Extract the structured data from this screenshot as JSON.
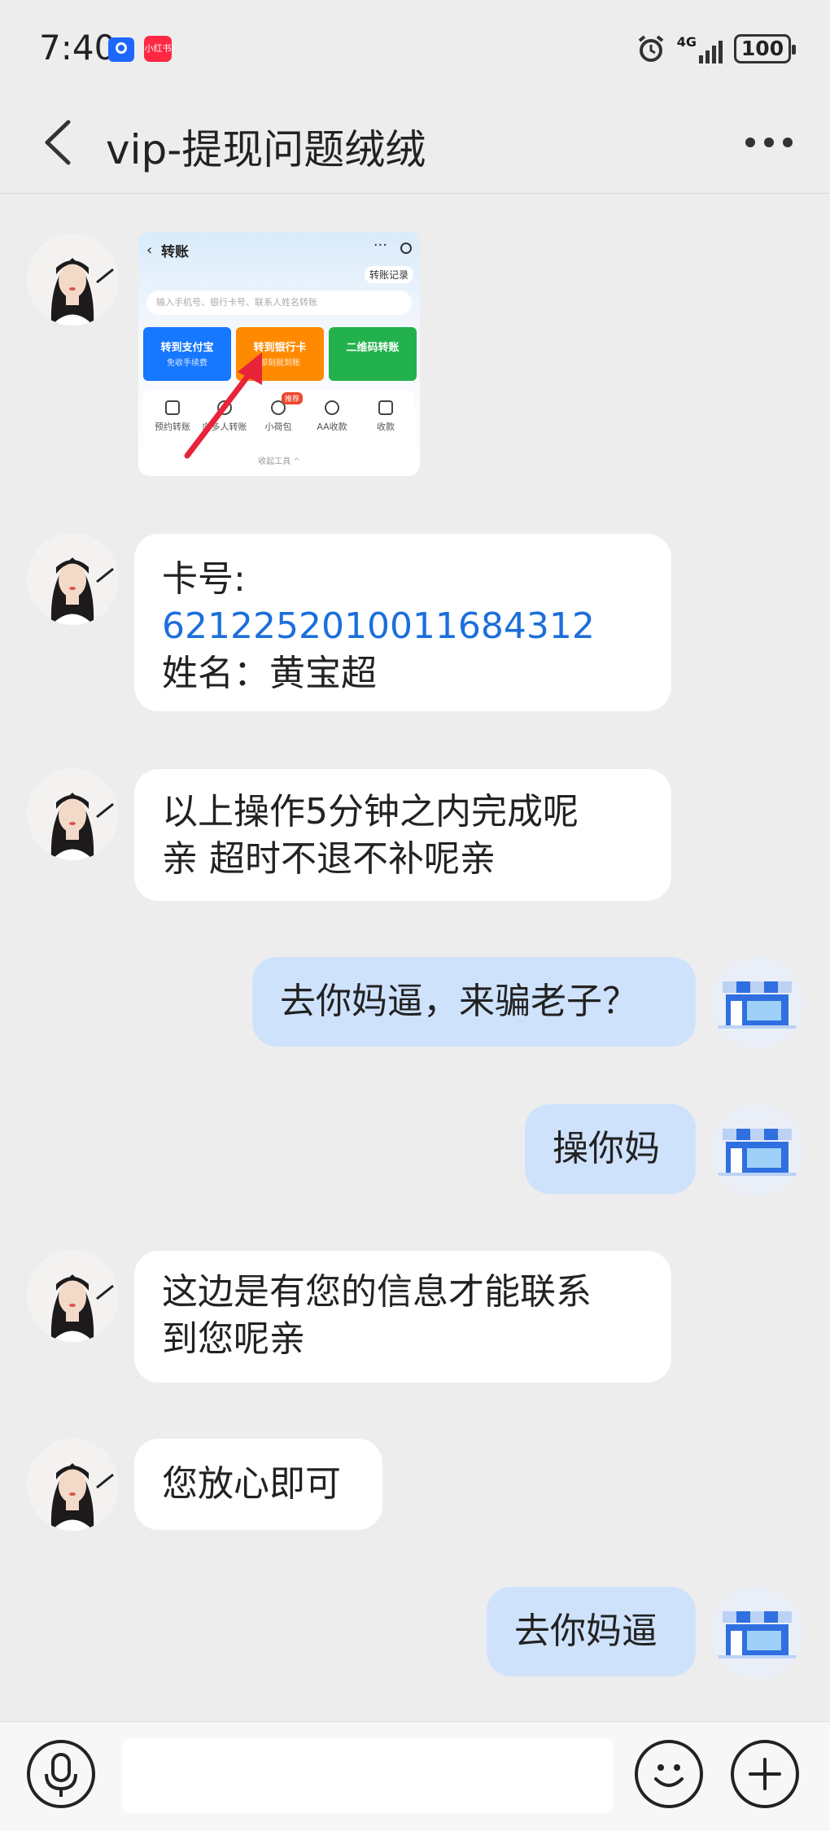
{
  "status_bar": {
    "time": "7:40",
    "app_badge_2_label": "小红书",
    "battery_level": "100",
    "network": "4G"
  },
  "header": {
    "title": "vip-提现问题绒绒"
  },
  "image_message": {
    "title": "转账",
    "record_label": "转账记录",
    "search_placeholder": "输入手机号、银行卡号、联系人姓名转账",
    "buttons": [
      {
        "label": "转到支付宝",
        "sub": "免收手续费",
        "color": "#1677ff"
      },
      {
        "label": "转到银行卡",
        "sub": "即刻就到账",
        "color": "#ff8a00"
      },
      {
        "label": "二维码转账",
        "sub": "",
        "color": "#22b14c"
      }
    ],
    "tools": [
      "预约转账",
      "向多人转账",
      "小荷包",
      "AA收款",
      "收款"
    ],
    "recommend_tag": "推荐",
    "collapse_label": "收起工具 ^"
  },
  "messages": [
    {
      "id": "m1",
      "lines": [
        "卡号:",
        "6212252010011684312",
        "姓名：黄宝超"
      ]
    },
    {
      "id": "m2",
      "lines": [
        "以上操作5分钟之内完成呢",
        "亲 超时不退不补呢亲"
      ]
    },
    {
      "id": "m3",
      "lines": [
        "去你妈逼，来骗老子？"
      ]
    },
    {
      "id": "m4",
      "lines": [
        "操你妈"
      ]
    },
    {
      "id": "m5",
      "lines": [
        "这边是有您的信息才能联系",
        "到您呢亲"
      ]
    },
    {
      "id": "m6",
      "lines": [
        "您放心即可"
      ]
    },
    {
      "id": "m7",
      "lines": [
        "去你妈逼"
      ]
    }
  ],
  "colors": {
    "background": "#ededed",
    "incoming_bubble": "#ffffff",
    "outgoing_bubble": "#cfe2fc",
    "card_number": "#1c6fdb",
    "arrow": "#e8233a"
  },
  "icons": {
    "back": "back-chevron-icon",
    "more": "more-dots-icon",
    "voice": "microphone-icon",
    "emoji": "smile-icon",
    "plus": "plus-icon",
    "store": "store-icon"
  }
}
